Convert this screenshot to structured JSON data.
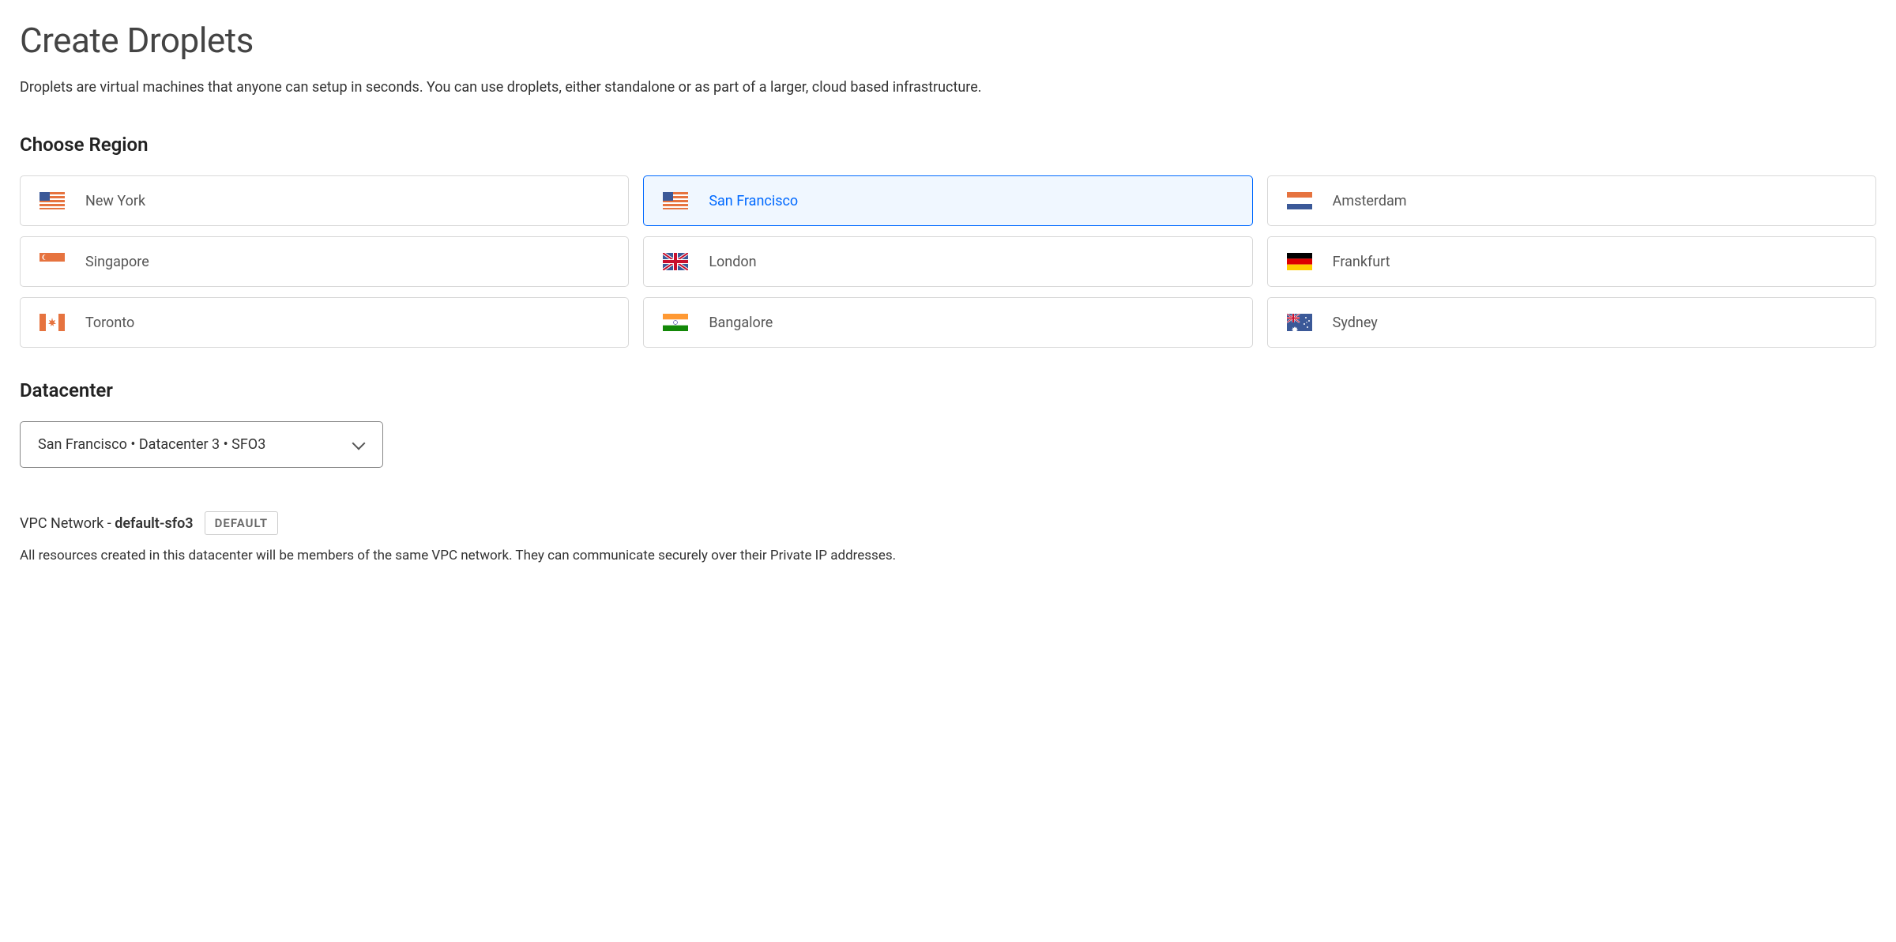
{
  "page": {
    "title": "Create Droplets",
    "description": "Droplets are virtual machines that anyone can setup in seconds. You can use droplets, either standalone or as part of a larger, cloud based infrastructure."
  },
  "region": {
    "heading": "Choose Region",
    "options": [
      {
        "label": "New York",
        "flag": "us",
        "selected": false
      },
      {
        "label": "San Francisco",
        "flag": "us",
        "selected": true
      },
      {
        "label": "Amsterdam",
        "flag": "nl",
        "selected": false
      },
      {
        "label": "Singapore",
        "flag": "sg",
        "selected": false
      },
      {
        "label": "London",
        "flag": "gb",
        "selected": false
      },
      {
        "label": "Frankfurt",
        "flag": "de",
        "selected": false
      },
      {
        "label": "Toronto",
        "flag": "ca",
        "selected": false
      },
      {
        "label": "Bangalore",
        "flag": "in",
        "selected": false
      },
      {
        "label": "Sydney",
        "flag": "au",
        "selected": false
      }
    ]
  },
  "datacenter": {
    "heading": "Datacenter",
    "selected_label": "San Francisco • Datacenter 3 • SFO3"
  },
  "vpc": {
    "label_prefix": "VPC Network - ",
    "network_name": "default-sfo3",
    "badge": "DEFAULT",
    "description": "All resources created in this datacenter will be members of the same VPC network. They can communicate securely over their Private IP addresses."
  }
}
